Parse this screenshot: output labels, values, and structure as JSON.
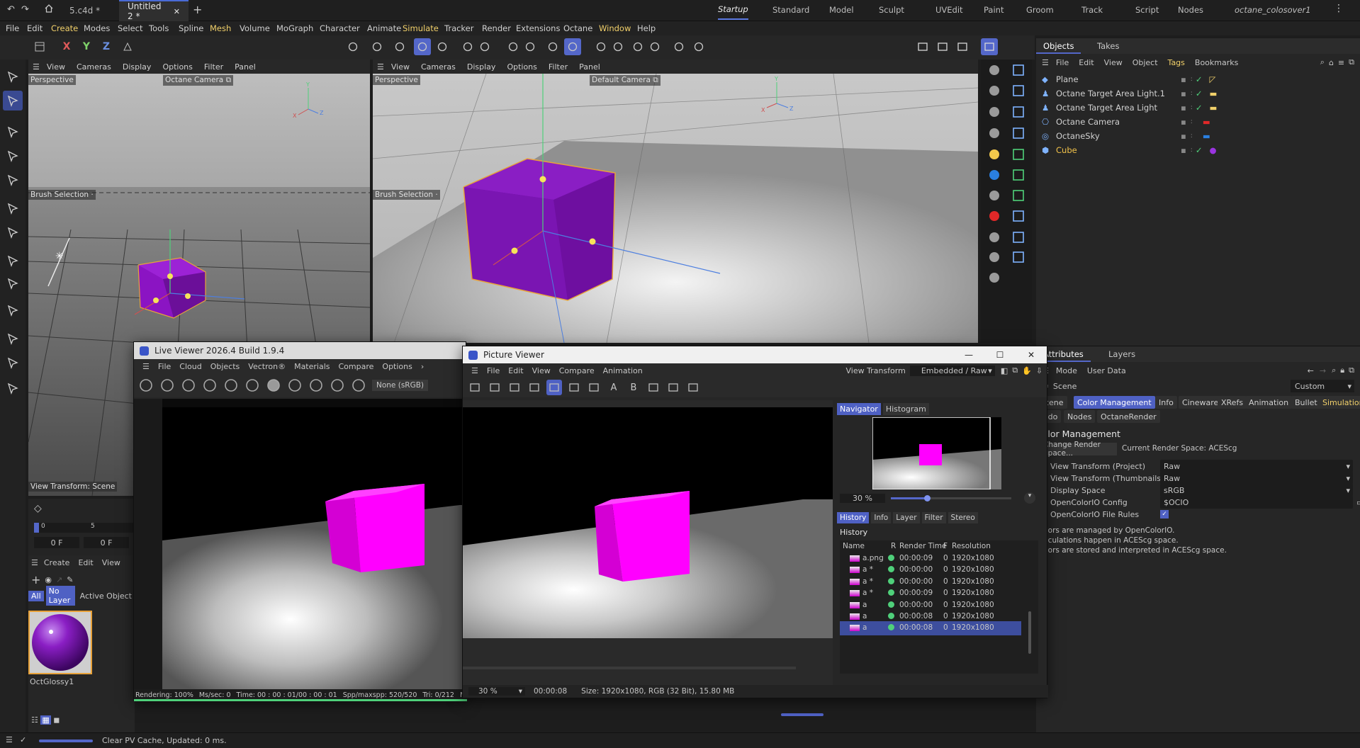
{
  "titlebar": {
    "doc1": "5.c4d *",
    "doc2": "Untitled 2 *",
    "close": "✕",
    "add": "+"
  },
  "layouts": [
    "Startup",
    "Standard",
    "Model",
    "Sculpt",
    "UVEdit",
    "Paint",
    "Groom",
    "Track",
    "Script",
    "Nodes",
    "octane_colosover1"
  ],
  "menubar": [
    "File",
    "Edit",
    "Create",
    "Modes",
    "Select",
    "Tools",
    "Spline",
    "Mesh",
    "Volume",
    "MoGraph",
    "Character",
    "Animate",
    "Simulate",
    "Tracker",
    "Render",
    "Extensions",
    "Octane",
    "Window",
    "Help"
  ],
  "axis": {
    "x": "X",
    "y": "Y",
    "z": "Z"
  },
  "viewport_menu": [
    "View",
    "Cameras",
    "Display",
    "Options",
    "Filter",
    "Panel"
  ],
  "vp_left": {
    "name": "Perspective",
    "camera": "Octane Camera",
    "brush": "Brush Selection",
    "view_transform": "View Transform: Scene"
  },
  "vp_right": {
    "name": "Perspective",
    "camera": "Default Camera",
    "brush": "Brush Selection"
  },
  "timeline": {
    "frame0": "0",
    "frame5": "5",
    "current": "0 F",
    "end": "0 F"
  },
  "material": {
    "menu": [
      "Create",
      "Edit",
      "View"
    ],
    "filters": [
      "All",
      "No Layer",
      "Active Object"
    ],
    "name": "OctGlossy1"
  },
  "objects": {
    "tabs": [
      "Objects",
      "Takes"
    ],
    "menu": [
      "File",
      "Edit",
      "View",
      "Object",
      "Tags",
      "Bookmarks"
    ],
    "items": [
      {
        "name": "Plane",
        "color": "#d0d0d0"
      },
      {
        "name": "Octane Target Area Light.1",
        "color": "#d0d0d0"
      },
      {
        "name": "Octane Target Area Light",
        "color": "#d0d0d0"
      },
      {
        "name": "Octane Camera",
        "color": "#d0d0d0"
      },
      {
        "name": "OctaneSky",
        "color": "#d0d0d0"
      },
      {
        "name": "Cube",
        "color": "#f1c24a"
      }
    ]
  },
  "attributes": {
    "tabs": [
      "Attributes",
      "Layers"
    ],
    "menu": [
      "Mode",
      "User Data"
    ],
    "scene_label": "Scene",
    "preset": "Custom",
    "chips1": [
      "Scene",
      "Color Management",
      "Info",
      "Cineware",
      "XRefs",
      "Animation",
      "Bullet",
      "Simulation"
    ],
    "chips2": [
      "Todo",
      "Nodes",
      "OctaneRender"
    ],
    "section": "Color Management",
    "change_btn": "Change Render Space...",
    "current_space": "Current Render Space: ACEScg",
    "fields": [
      {
        "label": "View Transform (Project)",
        "value": "Raw"
      },
      {
        "label": "View Transform (Thumbnails)",
        "value": "Raw"
      },
      {
        "label": "Display Space",
        "value": "sRGB"
      },
      {
        "label": "OpenColorIO Config",
        "value": "$OCIO"
      }
    ],
    "file_rules": "OpenColorIO File Rules",
    "notes": [
      "Colors are managed by OpenColorIO.",
      "Calculations happen in ACEScg space.",
      "Colors are stored and interpreted in ACEScg space."
    ]
  },
  "live_viewer": {
    "title": "Live Viewer 2026.4 Build 1.9.4",
    "menu": [
      "File",
      "Cloud",
      "Objects",
      "Vectron®",
      "Materials",
      "Compare",
      "Options"
    ],
    "more": "›",
    "dropdown": "None (sRGB)",
    "status": {
      "rendering": "Rendering: 100%",
      "ms": "Ms/sec: 0",
      "time": "Time: 00 : 00 : 01/00 : 00 : 01",
      "spp": "Spp/maxspp: 520/520",
      "tri": "Tri: 0/212",
      "me": "Me"
    },
    "progress": 1.0
  },
  "picture_viewer": {
    "title": "Picture Viewer",
    "menu": [
      "File",
      "Edit",
      "View",
      "Compare",
      "Animation"
    ],
    "view_transform_label": "View Transform",
    "view_transform": "Embedded / Raw",
    "tool_labels": {
      "a": "A",
      "b": "B"
    },
    "nav_tabs": [
      "Navigator",
      "Histogram"
    ],
    "zoom": "30 %",
    "zoom_level": 0.3,
    "hist_tabs": [
      "History",
      "Info",
      "Layer",
      "Filter",
      "Stereo"
    ],
    "history_title": "History",
    "columns": [
      "Name",
      "R",
      "Render Time",
      "F",
      "Resolution"
    ],
    "rows": [
      {
        "name": "a.png",
        "time": "00:00:09",
        "f": "0",
        "res": "1920x1080"
      },
      {
        "name": "a *",
        "time": "00:00:00",
        "f": "0",
        "res": "1920x1080"
      },
      {
        "name": "a *",
        "time": "00:00:00",
        "f": "0",
        "res": "1920x1080"
      },
      {
        "name": "a *",
        "time": "00:00:09",
        "f": "0",
        "res": "1920x1080"
      },
      {
        "name": "a",
        "time": "00:00:00",
        "f": "0",
        "res": "1920x1080"
      },
      {
        "name": "a",
        "time": "00:00:08",
        "f": "0",
        "res": "1920x1080"
      },
      {
        "name": "a",
        "time": "00:00:08",
        "f": "0",
        "res": "1920x1080"
      }
    ],
    "footer": {
      "zoom": "30 %",
      "time": "00:00:08",
      "size": "Size: 1920x1080, RGB (32 Bit), 15.80 MB"
    }
  },
  "status": {
    "text": "Clear PV Cache, Updated: 0 ms."
  },
  "colors": {
    "accent": "#5467c9",
    "cube": "#c000d8",
    "render_cube": "#ff00ff"
  }
}
